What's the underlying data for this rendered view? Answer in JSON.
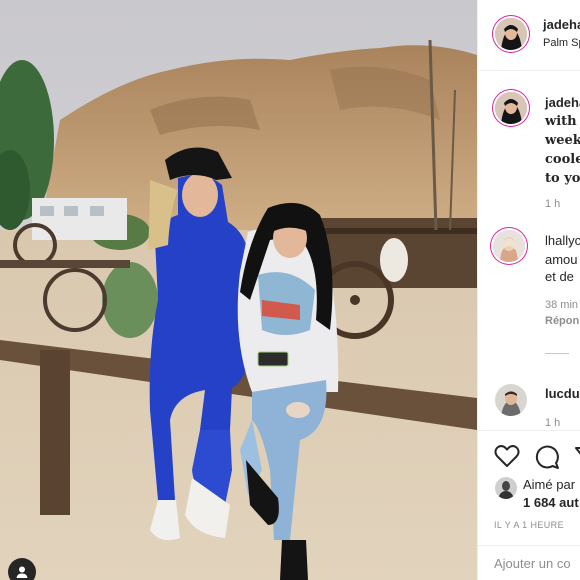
{
  "post": {
    "photo_alt": "Two people sitting on a wooden fence in the desert",
    "owner_icon": "user-icon"
  },
  "header": {
    "username": "jadeha",
    "location": "Palm Sp"
  },
  "caption": {
    "username": "jadeha",
    "lines": [
      "with r",
      "week",
      "coole",
      "to you"
    ],
    "time": "1 h"
  },
  "comments": [
    {
      "username": "lhallyc",
      "lines": [
        "amou",
        "et de"
      ],
      "time": "38 min",
      "reply_label": "Répon"
    },
    {
      "username": "lucdu",
      "time": "1 h"
    }
  ],
  "actions": {
    "icons": [
      "heart-icon",
      "comment-icon",
      "share-icon"
    ]
  },
  "likes": {
    "line1": "Aimé par",
    "line2": "1 684 aut"
  },
  "timestamp": "IL Y A 1 HEURE",
  "add_comment": {
    "placeholder": "Ajouter un co"
  },
  "colors": {
    "blue_outfit": "#2541c7",
    "sand": "#d8c2a4",
    "sky": "#cfcfd2",
    "story_ring": "#d6249f"
  }
}
